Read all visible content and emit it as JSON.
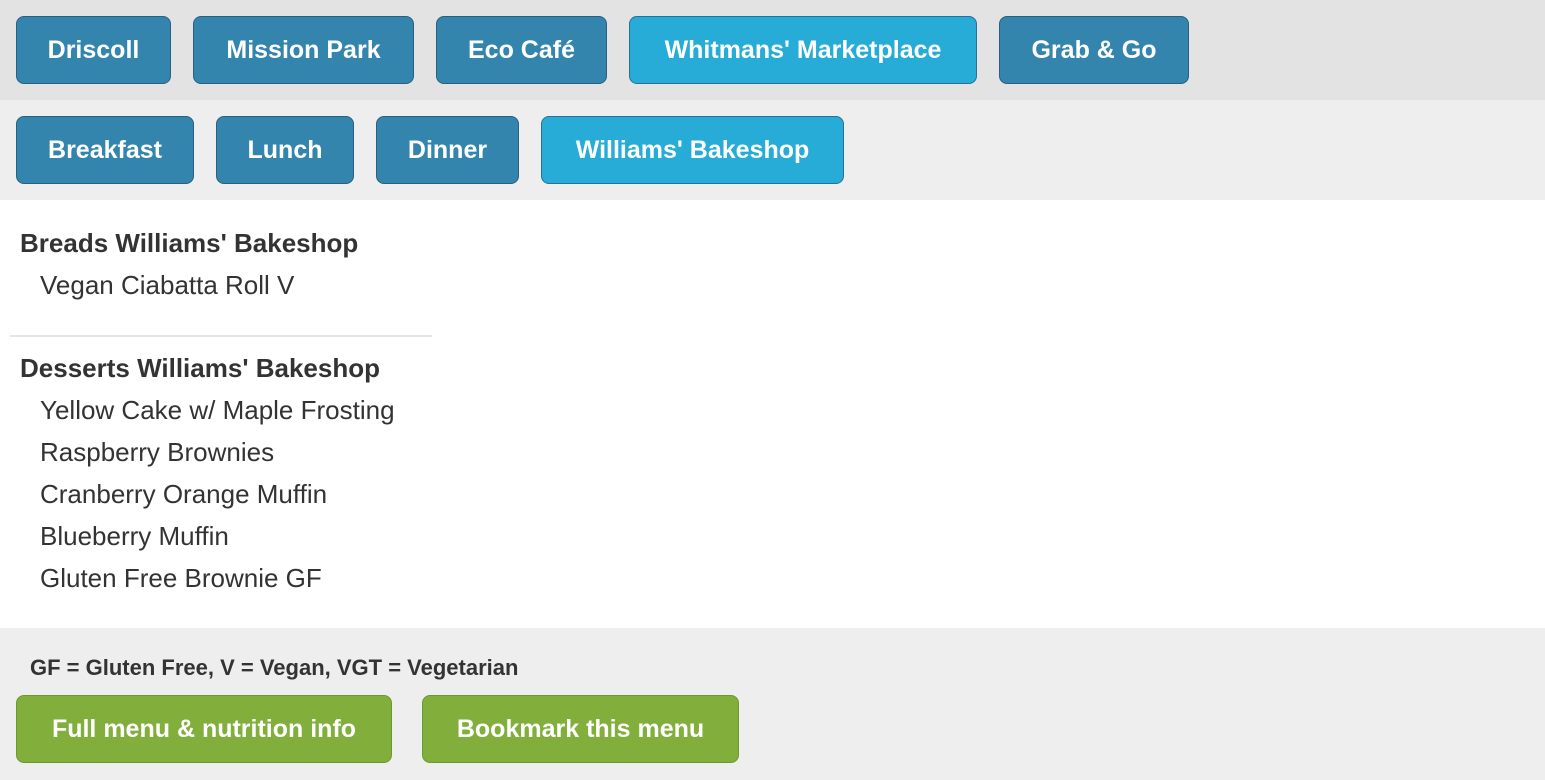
{
  "locations": [
    {
      "label": "Driscoll",
      "active": false
    },
    {
      "label": "Mission Park",
      "active": false
    },
    {
      "label": "Eco Café",
      "active": false
    },
    {
      "label": "Whitmans' Marketplace",
      "active": true
    },
    {
      "label": "Grab & Go",
      "active": false
    }
  ],
  "meals": [
    {
      "label": "Breakfast",
      "active": false
    },
    {
      "label": "Lunch",
      "active": false
    },
    {
      "label": "Dinner",
      "active": false
    },
    {
      "label": "Williams' Bakeshop",
      "active": true
    }
  ],
  "menu": {
    "sections": [
      {
        "title": "Breads Williams' Bakeshop",
        "items": [
          "Vegan Ciabatta Roll V"
        ]
      },
      {
        "title": "Desserts Williams' Bakeshop",
        "items": [
          "Yellow Cake w/ Maple Frosting",
          "Raspberry Brownies",
          "Cranberry Orange Muffin",
          "Blueberry Muffin",
          "Gluten Free Brownie GF"
        ]
      }
    ]
  },
  "footer": {
    "legend": "GF = Gluten Free, V = Vegan, VGT = Vegetarian",
    "full_menu_label": "Full menu & nutrition info",
    "bookmark_label": "Bookmark this menu"
  },
  "colors": {
    "button_blue": "#3385ad",
    "button_active": "#26acd6",
    "button_green": "#82ae3c"
  }
}
